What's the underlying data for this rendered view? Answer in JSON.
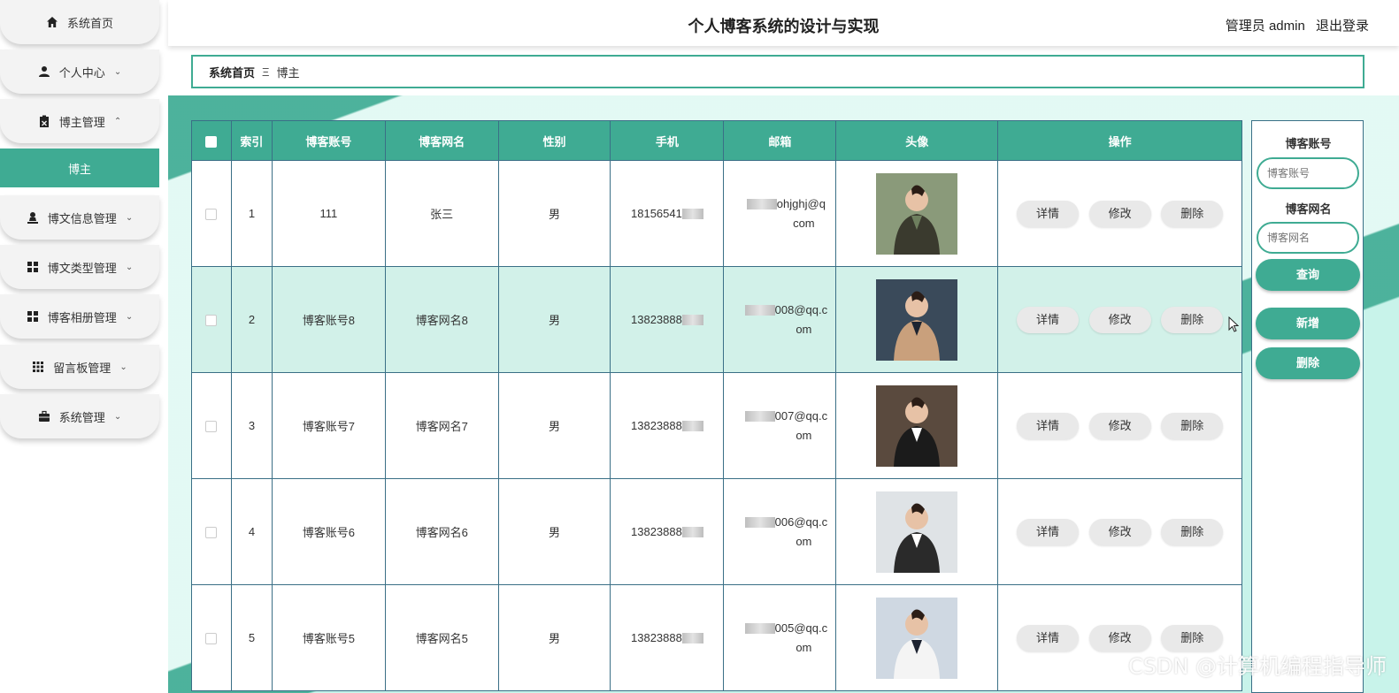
{
  "header": {
    "title": "个人博客系统的设计与实现",
    "user_label": "管理员 admin",
    "logout": "退出登录"
  },
  "breadcrumb": {
    "home": "系统首页",
    "sep": "Ξ",
    "current": "博主"
  },
  "sidebar": {
    "items": [
      {
        "label": "系统首页",
        "icon": "home-icon"
      },
      {
        "label": "个人中心",
        "icon": "user-icon"
      },
      {
        "label": "博主管理",
        "icon": "clipboard-icon"
      },
      {
        "label": "博文信息管理",
        "icon": "person-stamp-icon"
      },
      {
        "label": "博文类型管理",
        "icon": "grid-icon"
      },
      {
        "label": "博客相册管理",
        "icon": "grid-icon"
      },
      {
        "label": "留言板管理",
        "icon": "grid9-icon"
      },
      {
        "label": "系统管理",
        "icon": "briefcase-icon"
      }
    ],
    "sub_active": "博主"
  },
  "table": {
    "columns": [
      "索引",
      "博客账号",
      "博客网名",
      "性别",
      "手机",
      "邮箱",
      "头像",
      "操作"
    ],
    "actions": [
      "详情",
      "修改",
      "删除"
    ],
    "rows": [
      {
        "index": "1",
        "account": "111",
        "nickname": "张三",
        "gender": "男",
        "phone": "18156541",
        "email_l1": "ohjghj@q",
        "email_l2": "com"
      },
      {
        "index": "2",
        "account": "博客账号8",
        "nickname": "博客网名8",
        "gender": "男",
        "phone": "13823888",
        "email_l1": "008@qq.c",
        "email_l2": "om"
      },
      {
        "index": "3",
        "account": "博客账号7",
        "nickname": "博客网名7",
        "gender": "男",
        "phone": "13823888",
        "email_l1": "007@qq.c",
        "email_l2": "om"
      },
      {
        "index": "4",
        "account": "博客账号6",
        "nickname": "博客网名6",
        "gender": "男",
        "phone": "13823888",
        "email_l1": "006@qq.c",
        "email_l2": "om"
      },
      {
        "index": "5",
        "account": "博客账号5",
        "nickname": "博客网名5",
        "gender": "男",
        "phone": "13823888",
        "email_l1": "005@qq.c",
        "email_l2": "om"
      }
    ]
  },
  "search": {
    "account_label": "博客账号",
    "account_placeholder": "博客账号",
    "nickname_label": "博客网名",
    "nickname_placeholder": "博客网名",
    "query_btn": "查询",
    "add_btn": "新增",
    "delete_btn": "删除"
  },
  "watermark": "CSDN @计算机编程指导师",
  "colors": {
    "accent": "#3fab93",
    "row_highlight": "#d2f1e9",
    "border": "#3a6f86"
  }
}
